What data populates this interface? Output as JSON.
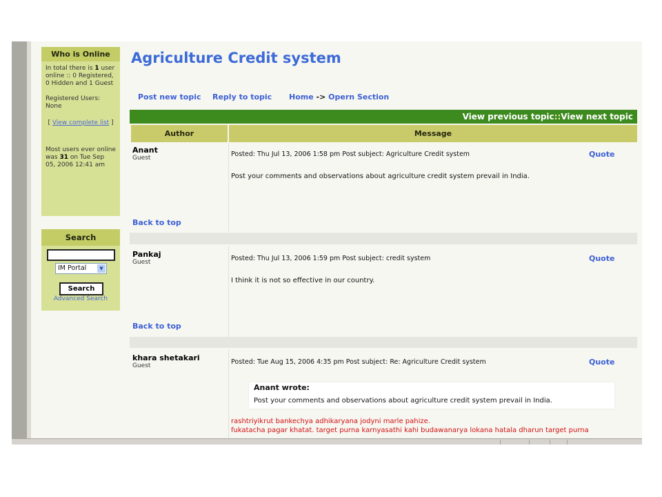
{
  "page": {
    "title": "Agriculture Credit system"
  },
  "nav": {
    "post_new_topic": "Post new topic",
    "reply_to_topic": "Reply to topic",
    "home": "Home",
    "arrow": "->",
    "section": "Opern Section"
  },
  "topic_nav": {
    "previous": "View previous topic",
    "separator": "::",
    "next": "View next topic"
  },
  "table": {
    "author_header": "Author",
    "message_header": "Message"
  },
  "who_online": {
    "title": "Who is Online",
    "line1_pre": "In total there is ",
    "line1_count": "1",
    "line1_rest": "user online :: 0 Registered, 0 Hidden and 1 Guest",
    "registered_users": "Registered Users: None",
    "view_list_open": "[ ",
    "view_list_link": "View complete list",
    "view_list_close": " ]",
    "most_users_pre": "Most users ever online was ",
    "most_users_count": "31",
    "most_users_rest": " on Tue Sep 05, 2006 12:41 am"
  },
  "search": {
    "title": "Search",
    "input_value": "",
    "select_value": "IM Portal",
    "button_label": "Search",
    "advanced_link": "Advanced Search"
  },
  "posts": [
    {
      "author": "Anant",
      "role": "Guest",
      "meta": "Posted: Thu Jul 13, 2006 1:58 pm    Post subject: Agriculture Credit system",
      "quote": "Quote",
      "body": "Post your comments and observations about agriculture credit system prevail in India.",
      "back_to_top": "Back to top"
    },
    {
      "author": "Pankaj",
      "role": "Guest",
      "meta": "Posted: Thu Jul 13, 2006 1:59 pm    Post subject: credit system",
      "quote": "Quote",
      "body": "I think it is not so effective in our country.",
      "back_to_top": "Back to top"
    },
    {
      "author": "khara shetakari",
      "role": "Guest",
      "meta": "Posted: Tue Aug 15, 2006 4:35 pm    Post subject: Re: Agriculture Credit system",
      "quote": "Quote",
      "quoted_author": "Anant wrote:",
      "quoted_text": "Post your comments and observations about agriculture credit system prevail in India.",
      "red_line1": "rashtriyikrut bankechya adhikaryana jodyni marle pahize.",
      "red_line2": "fukatacha pagar khatat. target purna karnyasathi kahi budawanarya lokana hatala dharun target purna"
    }
  ],
  "colors": {
    "header_green": "#3d8a1f",
    "table_header": "#c9cb6b",
    "sidebar_bg": "#d7e196",
    "link_blue": "#3c5fd4",
    "title_blue": "#3c6ad8",
    "reply_red": "#d01010"
  }
}
